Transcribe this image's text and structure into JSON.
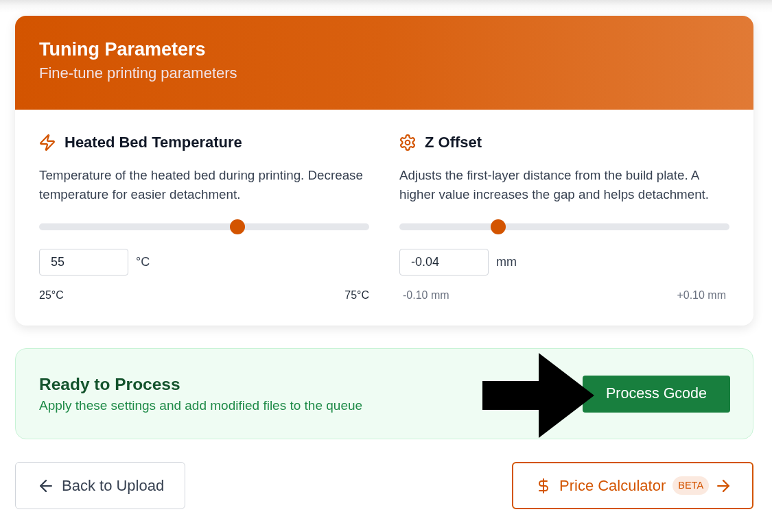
{
  "header": {
    "title": "Tuning Parameters",
    "subtitle": "Fine-tune printing parameters"
  },
  "parameters": [
    {
      "title": "Heated Bed Temperature",
      "description": "Temperature of the heated bed during printing. Decrease temperature for easier detachment.",
      "level": 0.6,
      "value": "55",
      "unit": "°C",
      "range_min": "25°C",
      "range_max": "75°C",
      "range_muted": false
    },
    {
      "title": "Z Offset",
      "description": "Adjusts the first-layer distance from the build plate. A higher value increases the gap and helps detachment.",
      "level": 0.3,
      "value": "-0.04",
      "unit": "mm",
      "range_min": "-0.10 mm",
      "range_max": "+0.10 mm",
      "range_muted": true
    }
  ],
  "ready": {
    "title": "Ready to Process",
    "subtitle": "Apply these settings and add modified files to the queue",
    "button": "Process Gcode",
    "pointer_arrow": true
  },
  "navigation": [
    {
      "kind": "back",
      "label": "Back to Upload"
    },
    {
      "kind": "calculator",
      "label": "Price Calculator",
      "badge": "BETA"
    }
  ]
}
